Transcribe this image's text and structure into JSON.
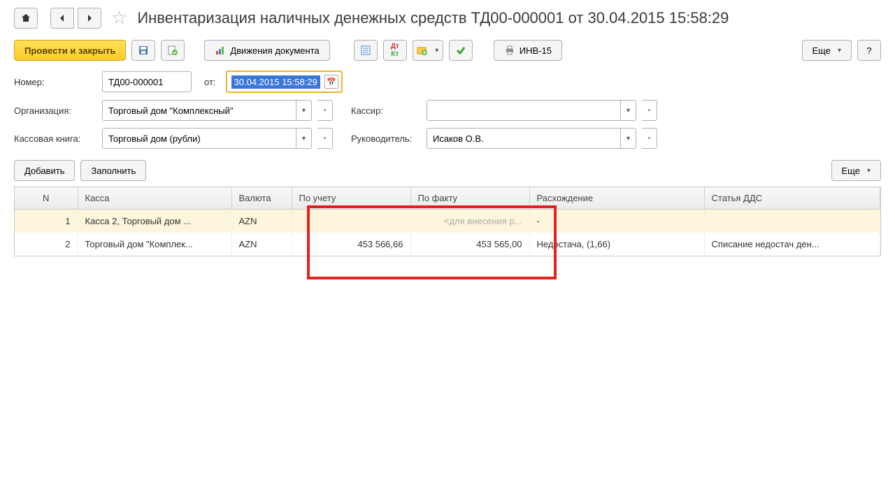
{
  "header": {
    "title": "Инвентаризация наличных денежных средств ТД00-000001 от 30.04.2015 15:58:29"
  },
  "toolbar": {
    "post_and_close": "Провести и закрыть",
    "movements": "Движения документа",
    "inv_form": "ИНВ-15",
    "more": "Еще",
    "help": "?"
  },
  "form": {
    "number_label": "Номер:",
    "number_value": "ТД00-000001",
    "from_label": "от:",
    "date_value": "30.04.2015 15:58:29",
    "org_label": "Организация:",
    "org_value": "Торговый дом \"Комплексный\"",
    "cashier_label": "Кассир:",
    "cashier_value": "",
    "book_label": "Кассовая книга:",
    "book_value": "Торговый дом (рубли)",
    "manager_label": "Руководитель:",
    "manager_value": "Исаков О.В."
  },
  "table_actions": {
    "add": "Добавить",
    "fill": "Заполнить",
    "more": "Еще"
  },
  "columns": {
    "n": "N",
    "kassa": "Касса",
    "valuta": "Валюта",
    "po_uchetu": "По учету",
    "po_faktu": "По факту",
    "rash": "Расхождение",
    "dds": "Статья ДДС"
  },
  "rows": [
    {
      "n": "1",
      "kassa": "Касса 2, Торговый дом ...",
      "valuta": "AZN",
      "po_uchetu": "",
      "po_faktu": "<для внесения р...",
      "rash": "-",
      "dds": ""
    },
    {
      "n": "2",
      "kassa": "Торговый дом \"Комплек...",
      "valuta": "AZN",
      "po_uchetu": "453 566,66",
      "po_faktu": "453 565,00",
      "rash": "Недостача, (1,66)",
      "dds": "Списание недостач ден..."
    }
  ]
}
